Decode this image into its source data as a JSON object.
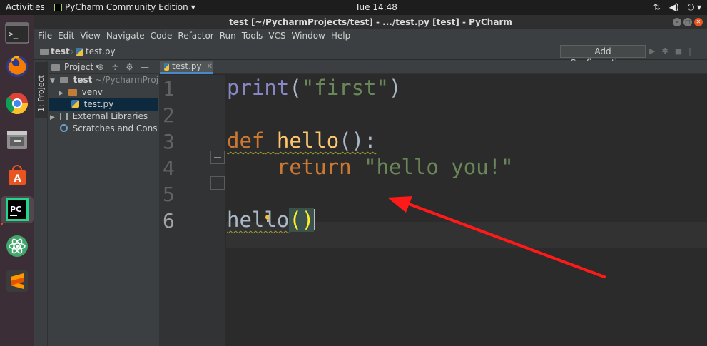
{
  "topbar": {
    "activities": "Activities",
    "app_name": "PyCharm Community Edition",
    "clock": "Tue 14:48",
    "tray_icons": [
      "network-icon",
      "volume-icon",
      "power-icon"
    ]
  },
  "dock": {
    "items": [
      "terminal",
      "firefox",
      "chrome",
      "files",
      "software-center",
      "pycharm",
      "atom",
      "sublime-text"
    ],
    "active": "pycharm"
  },
  "window": {
    "title": "test [~/PycharmProjects/test] - .../test.py [test] - PyCharm"
  },
  "menu": [
    "File",
    "Edit",
    "View",
    "Navigate",
    "Code",
    "Refactor",
    "Run",
    "Tools",
    "VCS",
    "Window",
    "Help"
  ],
  "navbar": {
    "crumb_project": "test",
    "crumb_file": "test.py",
    "add_config": "Add Configuration..."
  },
  "stripe": {
    "project_tab": "1: Project"
  },
  "project": {
    "header": "Project",
    "root_name": "test",
    "root_path": "~/PycharmProject",
    "venv": "venv",
    "file": "test.py",
    "ext_libs": "External Libraries",
    "scratches": "Scratches and Consoles"
  },
  "editor": {
    "tab": "test.py",
    "line_numbers": [
      "1",
      "2",
      "3",
      "4",
      "5",
      "6"
    ],
    "current_line": 6,
    "code": {
      "l1_fn": "print",
      "l1_open": "(",
      "l1_str": "\"first\"",
      "l1_close": ")",
      "l3_kw": "def",
      "l3_fn": "hello",
      "l3_rest": "():",
      "l4_kw": "return",
      "l4_str": "\"hello you!\"",
      "l6_fn": "hello",
      "l6_parens": "()"
    }
  },
  "annotation": {
    "arrow_color": "#ff1a1a"
  }
}
